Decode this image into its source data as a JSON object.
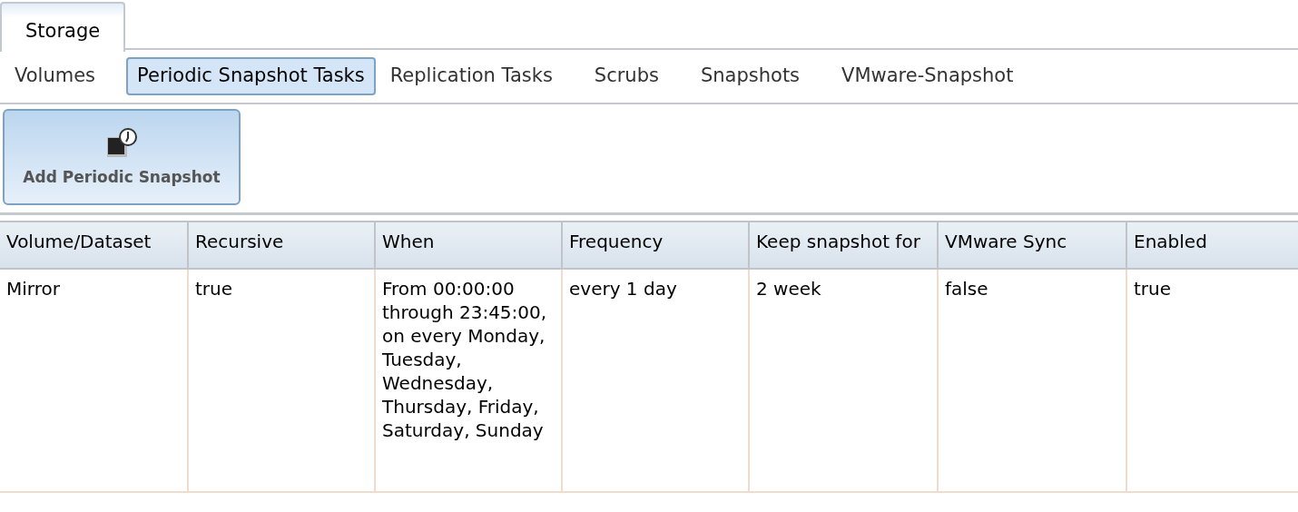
{
  "main_tabs": [
    {
      "label": "Storage",
      "selected": true
    }
  ],
  "sub_tabs": [
    {
      "label": "Volumes",
      "selected": false
    },
    {
      "label": "Periodic Snapshot Tasks",
      "selected": true
    },
    {
      "label": "Replication Tasks",
      "selected": false
    },
    {
      "label": "Scrubs",
      "selected": false
    },
    {
      "label": "Snapshots",
      "selected": false
    },
    {
      "label": "VMware-Snapshot",
      "selected": false
    }
  ],
  "toolbar": {
    "add_button": "Add Periodic Snapshot"
  },
  "table": {
    "columns": [
      "Volume/Dataset",
      "Recursive",
      "When",
      "Frequency",
      "Keep snapshot for",
      "VMware Sync",
      "Enabled"
    ],
    "rows": [
      [
        "Mirror",
        "true",
        "From 00:00:00 through 23:45:00, on every Monday, Tuesday, Wednesday, Thursday, Friday, Saturday, Sunday",
        "every 1 day",
        "2 week",
        "false",
        "true"
      ]
    ]
  }
}
